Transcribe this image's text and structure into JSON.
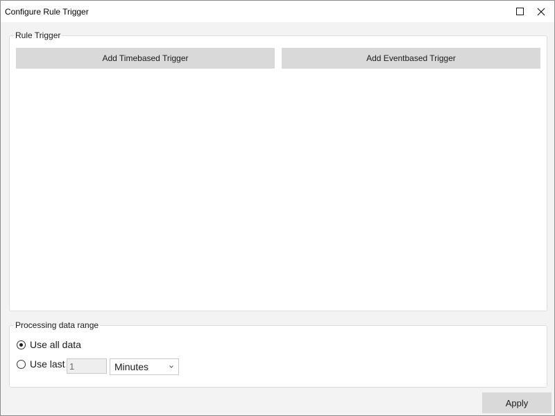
{
  "window": {
    "title": "Configure Rule Trigger",
    "controls": {
      "maximize_icon": "maximize-icon",
      "close_icon": "close-icon"
    }
  },
  "rule_trigger": {
    "legend": "Rule Trigger",
    "add_timebased_label": "Add Timebased Trigger",
    "add_eventbased_label": "Add Eventbased Trigger"
  },
  "processing_range": {
    "legend": "Processing data range",
    "use_all_label": "Use all data",
    "use_all_selected": true,
    "use_last_label": "Use last",
    "use_last_selected": false,
    "last_value": "1",
    "unit_selected": "Minutes",
    "unit_icon": "chevron-down-icon"
  },
  "footer": {
    "apply_label": "Apply"
  },
  "colors": {
    "button_bg": "#d9d9d9",
    "window_bg": "#f3f3f3",
    "panel_bg": "#ffffff",
    "border": "#dcdcdc"
  }
}
